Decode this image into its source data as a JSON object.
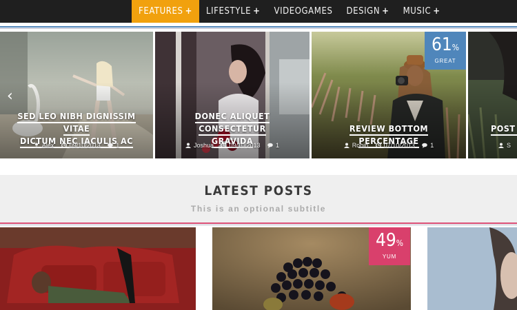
{
  "nav": {
    "items": [
      {
        "label": "FEATURES",
        "plus": "+",
        "active": true
      },
      {
        "label": "LIFESTYLE",
        "plus": "+"
      },
      {
        "label": "VIDEOGAMES",
        "plus": ""
      },
      {
        "label": "DESIGN",
        "plus": "+"
      },
      {
        "label": "MUSIC",
        "plus": "+"
      }
    ]
  },
  "slider": {
    "prev_icon": "chevron-left-icon",
    "slides": [
      {
        "title_line1": "SED LEO NIBH DIGNISSIM VITAE",
        "title_line2": "DICTUM NEC IACULIS AC",
        "author": "Alex",
        "date": "09/10/2013",
        "comments": "1"
      },
      {
        "title_line1": "DONEC ALIQUET CONSECTETUR",
        "title_line2": "GRAVIDA",
        "author": "Joshua",
        "date": "09/10/2013",
        "comments": "1"
      },
      {
        "title_line1": "REVIEW BOTTOM PERCENTAGE",
        "title_line2": "",
        "author": "Robin",
        "date": "07/10/2013",
        "comments": "1",
        "score": "61",
        "score_unit": "%",
        "score_label": "GREAT"
      },
      {
        "title_line1": "POST R",
        "title_line2": "",
        "author": "S",
        "date": "",
        "comments": ""
      }
    ]
  },
  "latest": {
    "title": "LATEST POSTS",
    "subtitle": "This is an optional subtitle",
    "posts": [
      {
        "score": "",
        "score_label": ""
      },
      {
        "score": "49",
        "score_unit": "%",
        "score_label": "YUM"
      },
      {
        "score": "",
        "score_label": ""
      }
    ]
  },
  "colors": {
    "accent": "#f1a10e",
    "nav_bg": "#1f1f1f",
    "score_blue": "#4f86bb",
    "score_pink": "#d9406c",
    "pink_line": "#d84c74",
    "blue_line": "#4f83b7"
  }
}
